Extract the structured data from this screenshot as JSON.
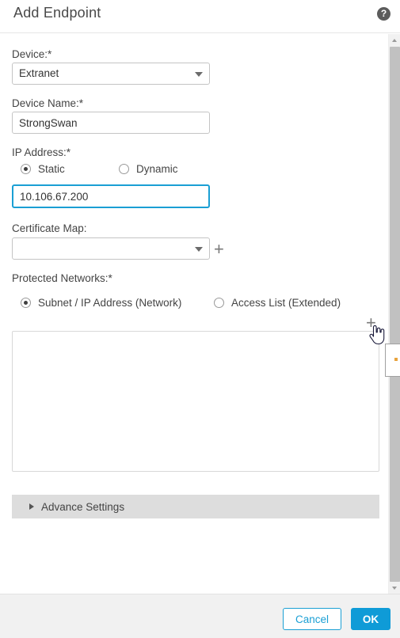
{
  "header": {
    "title": "Add Endpoint",
    "help_icon": "help-circle-icon",
    "help_glyph": "?"
  },
  "form": {
    "device": {
      "label": "Device:*",
      "value": "Extranet",
      "icon": "chevron-down-icon"
    },
    "device_name": {
      "label": "Device Name:*",
      "value": "StrongSwan",
      "placeholder": ""
    },
    "ip_address": {
      "label": "IP Address:*",
      "options": [
        {
          "label": "Static",
          "selected": true
        },
        {
          "label": "Dynamic",
          "selected": false
        }
      ],
      "value": "10.106.67.200",
      "placeholder": "",
      "focused": true
    },
    "certificate_map": {
      "label": "Certificate Map:",
      "value": "",
      "icon": "chevron-down-icon",
      "add_icon": "plus-icon",
      "add_glyph": "+"
    },
    "protected_networks": {
      "label": "Protected Networks:*",
      "options": [
        {
          "label": "Subnet / IP Address (Network)",
          "selected": true
        },
        {
          "label": "Access List (Extended)",
          "selected": false
        }
      ],
      "add_icon": "plus-icon",
      "add_glyph": "+",
      "list_items": []
    },
    "advance_settings": {
      "label": "Advance Settings",
      "icon": "caret-right-icon",
      "expanded": false
    }
  },
  "footer": {
    "cancel_label": "Cancel",
    "ok_label": "OK"
  },
  "scrollbar": {
    "up_icon": "caret-up-icon",
    "down_icon": "caret-down-icon",
    "thumb": "scrollbar-thumb"
  },
  "colors": {
    "accent": "#0f9bd7",
    "focus_border": "#1a9fd4",
    "footer_bg": "#f1f1f1",
    "advance_bar_bg": "#dddddd",
    "text": "#444444",
    "tooltip_dot": "#e8a33d"
  }
}
